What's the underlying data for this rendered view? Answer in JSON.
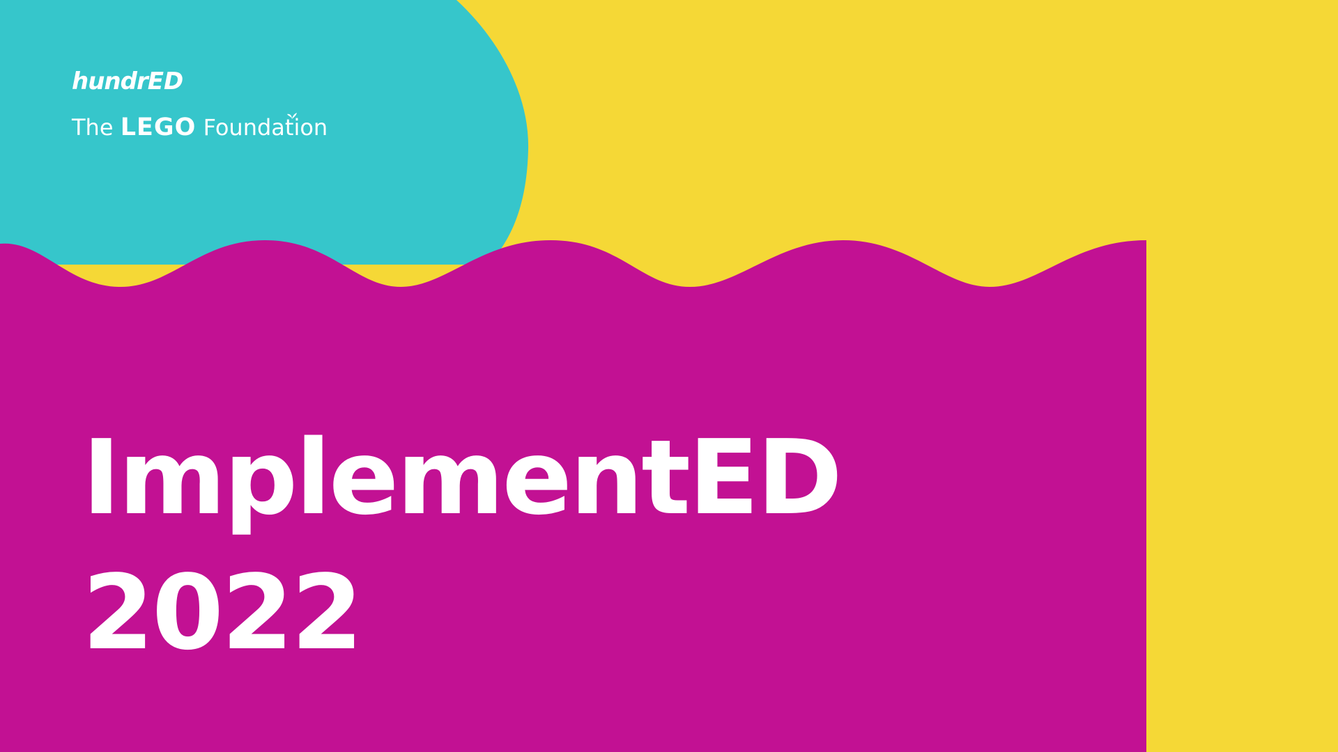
{
  "logos": {
    "hundred_prefix": "hundr",
    "hundred_suffix": "ED",
    "foundation_pre": "The ",
    "foundation_brand": "LEGO",
    "foundation_post": " Foundation"
  },
  "title": {
    "line1": "ImplementED",
    "line2": "2022"
  },
  "colors": {
    "background": "#f5d836",
    "teal_blob": "#36c6cb",
    "magenta_panel": "#c21193",
    "text": "#ffffff"
  }
}
